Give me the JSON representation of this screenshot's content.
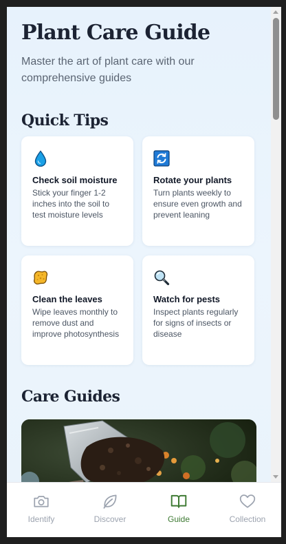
{
  "header": {
    "title": "Plant Care Guide",
    "subtitle": "Master the art of plant care with our comprehensive guides"
  },
  "quick_tips": {
    "title": "Quick Tips",
    "items": [
      {
        "icon": "water-drop-icon",
        "title": "Check soil moisture",
        "text": "Stick your finger 1-2 inches into the soil to test moisture levels"
      },
      {
        "icon": "rotate-icon",
        "title": "Rotate your plants",
        "text": "Turn plants weekly to ensure even growth and prevent leaning"
      },
      {
        "icon": "sponge-icon",
        "title": "Clean the leaves",
        "text": "Wipe leaves monthly to remove dust and improve photosynthesis"
      },
      {
        "icon": "magnifier-icon",
        "title": "Watch for pests",
        "text": "Inspect plants regularly for signs of insects or disease"
      }
    ]
  },
  "care_guides": {
    "title": "Care Guides"
  },
  "nav": {
    "items": [
      {
        "label": "Identify",
        "icon": "camera-icon",
        "active": false
      },
      {
        "label": "Discover",
        "icon": "leaf-icon",
        "active": false
      },
      {
        "label": "Guide",
        "icon": "book-icon",
        "active": true
      },
      {
        "label": "Collection",
        "icon": "heart-icon",
        "active": false
      }
    ]
  },
  "colors": {
    "accent": "#3e7a33",
    "heading": "#1c2333",
    "background": "#eaf4fd"
  }
}
